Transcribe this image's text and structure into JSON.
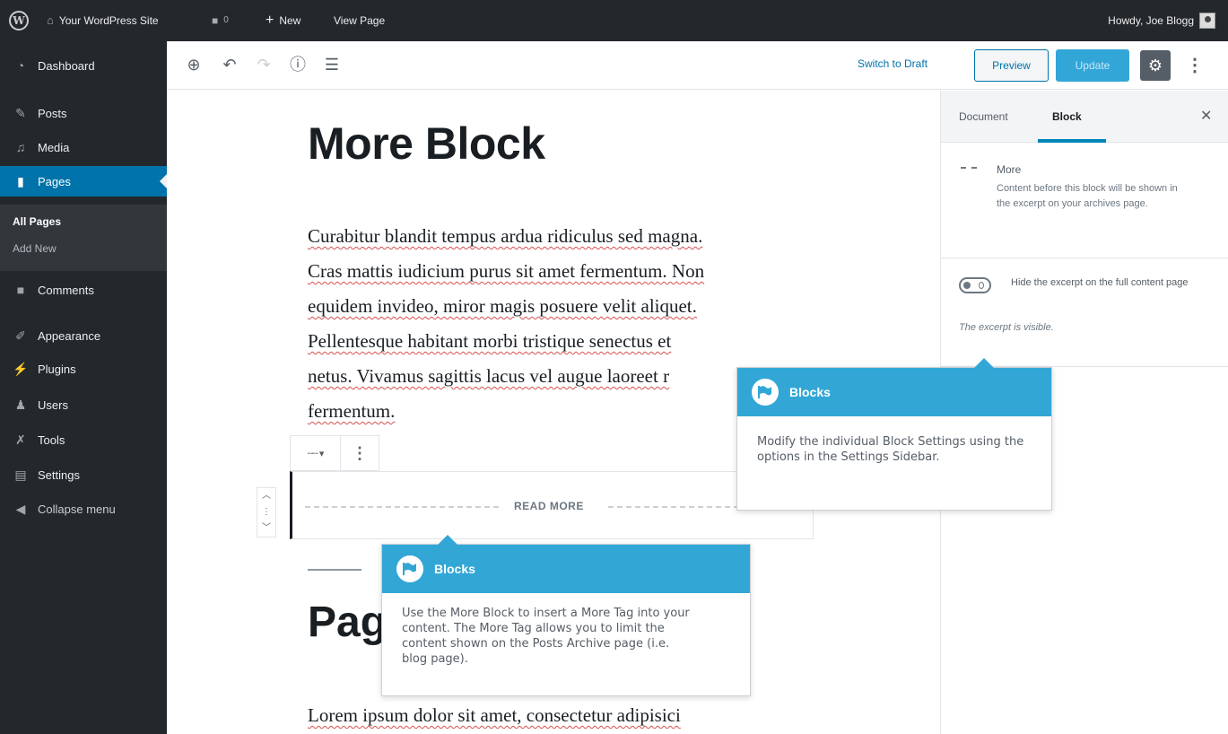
{
  "adminbar": {
    "site_name": "Your WordPress Site",
    "comments_count": "0",
    "new_label": "New",
    "view_page_label": "View Page",
    "howdy": "Howdy, Joe Blogg"
  },
  "sidebar": {
    "items": [
      {
        "label": "Dashboard",
        "icon": "dashboard-icon"
      },
      {
        "label": "Posts",
        "icon": "pin-icon"
      },
      {
        "label": "Media",
        "icon": "media-icon"
      },
      {
        "label": "Pages",
        "icon": "pages-icon"
      },
      {
        "label": "Comments",
        "icon": "comment-icon"
      },
      {
        "label": "Appearance",
        "icon": "brush-icon"
      },
      {
        "label": "Plugins",
        "icon": "plug-icon"
      },
      {
        "label": "Users",
        "icon": "users-icon"
      },
      {
        "label": "Tools",
        "icon": "wrench-icon"
      },
      {
        "label": "Settings",
        "icon": "settings-icon"
      },
      {
        "label": "Collapse menu",
        "icon": "collapse-icon"
      }
    ],
    "submenu": {
      "all_pages": "All Pages",
      "add_new": "Add New"
    }
  },
  "toolbar": {
    "switch_to_draft": "Switch to Draft",
    "preview": "Preview",
    "update": "Update"
  },
  "content": {
    "title": "More Block",
    "paragraph_lines": [
      "Curabitur blandit tempus ardua ridiculus sed magna.",
      "Cras mattis iudicium purus sit amet fermentum. Non",
      "equidem invideo, miror magis posuere velit aliquet.",
      "Pellentesque habitant morbi tristique senectus et",
      "netus. Vivamus sagittis lacus vel augue laoreet r",
      "fermentum."
    ],
    "more_label": "READ MORE",
    "heading2": "Pag",
    "paragraph2": "Lorem ipsum dolor sit amet, consectetur adipisici"
  },
  "settings_panel": {
    "tab_document": "Document",
    "tab_block": "Block",
    "block_name": "More",
    "block_description": "Content before this block will be shown in the excerpt on your archives page.",
    "toggle_label": "Hide the excerpt on the full content page",
    "toggle_help": "The excerpt is visible."
  },
  "tooltips": {
    "settings_tip": {
      "title": "Blocks",
      "body": "Modify the individual Block Settings using the options in the Settings Sidebar."
    },
    "more_tip": {
      "title": "Blocks",
      "body": "Use the More Block to insert a More Tag into your content. The More Tag allows you to limit the content shown on the Posts Archive page (i.e. blog page)."
    }
  },
  "colors": {
    "admin_dark": "#23282d",
    "accent_blue": "#0073aa",
    "tooltip_blue": "#32a7d6"
  }
}
